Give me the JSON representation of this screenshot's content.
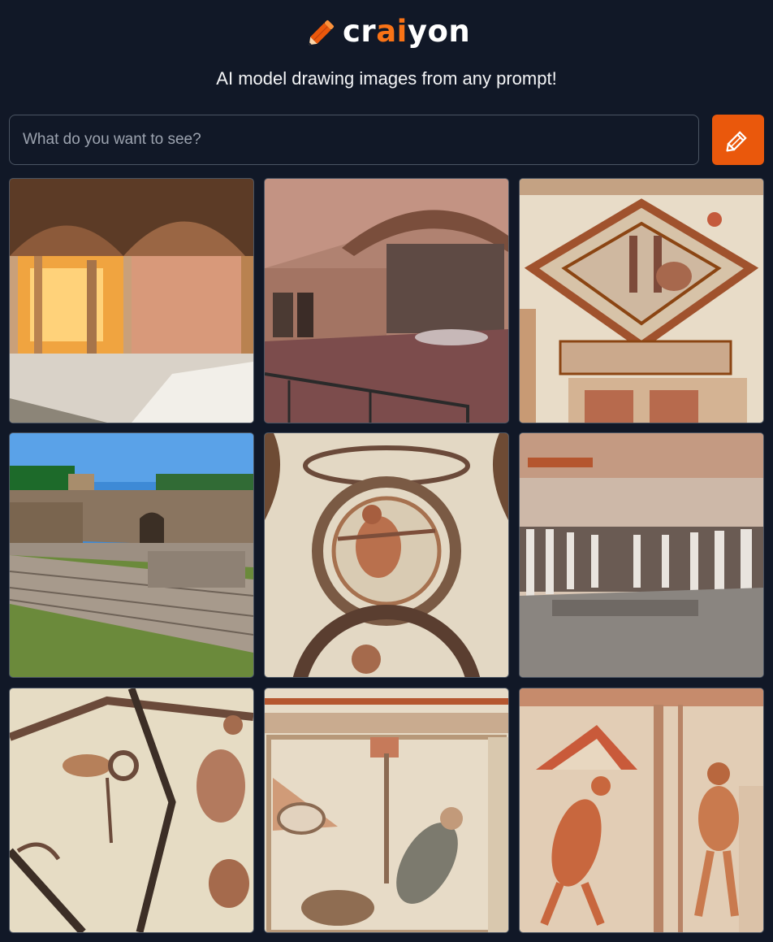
{
  "brand": {
    "name_prefix": "cr",
    "name_accent": "ai",
    "name_suffix": "yon",
    "accent_color": "#f97316",
    "icon": "pencil-icon"
  },
  "tagline": "AI model drawing images from any prompt!",
  "search": {
    "placeholder": "What do you want to see?",
    "value": ""
  },
  "draw_button": {
    "icon": "pencil-icon",
    "color": "#ea580c"
  },
  "images": [
    {
      "subject": "arched-roman-interior"
    },
    {
      "subject": "vaulted-brick-corridor"
    },
    {
      "subject": "geometric-mosaic"
    },
    {
      "subject": "stone-ruins-under-blue-sky"
    },
    {
      "subject": "circular-mosaic-with-figure"
    },
    {
      "subject": "colonnaded-hall"
    },
    {
      "subject": "mosaic-with-birds"
    },
    {
      "subject": "mosaic-with-bird-and-border"
    },
    {
      "subject": "mosaic-with-human-figures"
    }
  ]
}
